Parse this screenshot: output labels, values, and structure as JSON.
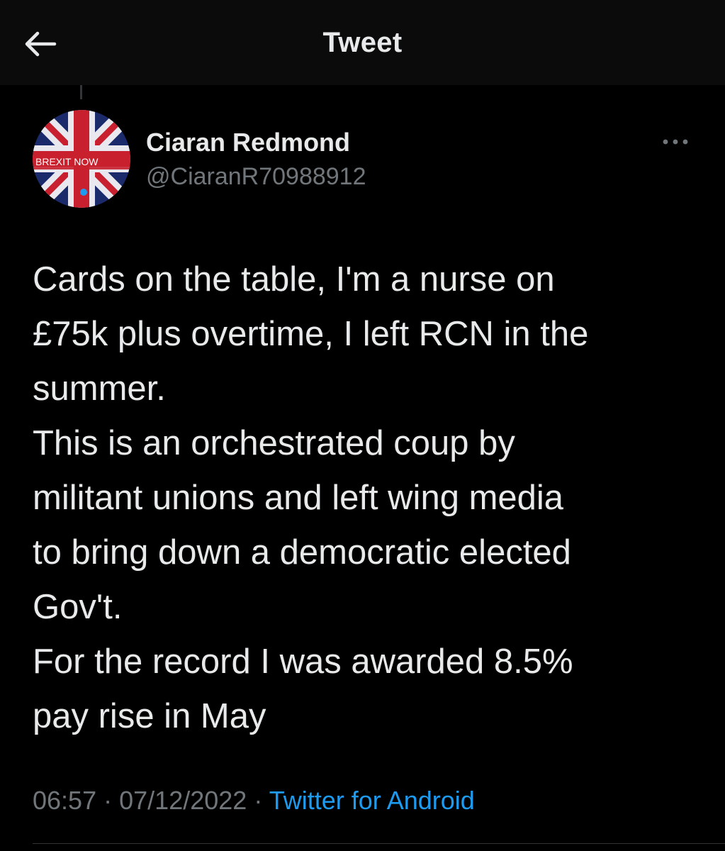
{
  "header": {
    "title": "Tweet",
    "back_icon": "arrow-left-icon"
  },
  "author": {
    "display_name": "Ciaran Redmond",
    "handle": "@CiaranR70988912",
    "avatar_text": "BREXIT NOW"
  },
  "tweet": {
    "text": "Cards on the table, I'm a nurse on\n£75k plus overtime, I left RCN in the\nsummer.\nThis is an orchestrated coup by\nmilitant unions and left wing media\nto bring down a democratic elected\nGov't.\nFor the record I was awarded 8.5%\npay rise in May",
    "time": "06:57",
    "date": "07/12/2022",
    "separator": "·",
    "source": "Twitter for Android"
  },
  "colors": {
    "background": "#000000",
    "text_primary": "#e7e9ea",
    "text_secondary": "#71767b",
    "link": "#1d9bf0"
  }
}
